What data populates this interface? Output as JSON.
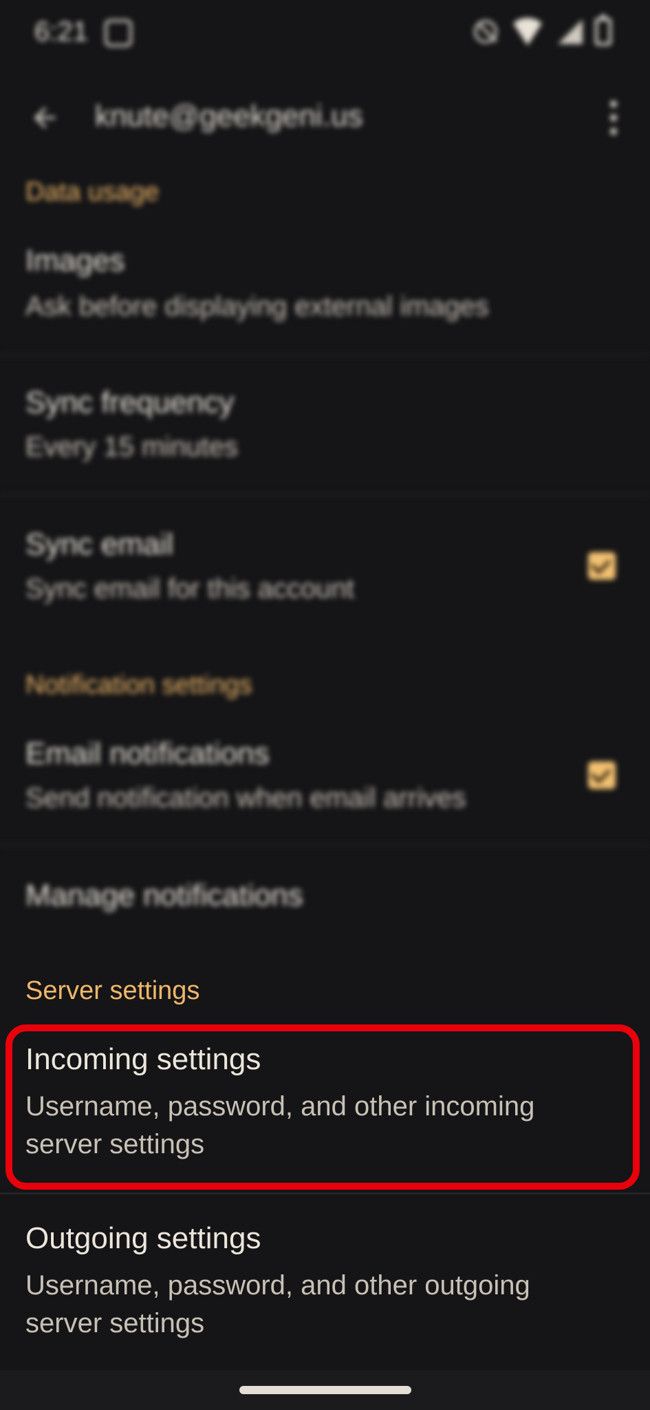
{
  "status_bar": {
    "time": "6:21",
    "icons": [
      "notification-icon",
      "mute-icon",
      "wifi-icon",
      "signal-icon",
      "battery-icon"
    ]
  },
  "app_bar": {
    "back_icon": "back-arrow-icon",
    "title": "knute@geekgeni.us",
    "more_icon": "more-vert-icon"
  },
  "sections": {
    "data_usage": {
      "header": "Data usage"
    },
    "notification": {
      "header": "Notification settings"
    },
    "server": {
      "header": "Server settings"
    }
  },
  "items": {
    "images": {
      "title": "Images",
      "subtitle": "Ask before displaying external images"
    },
    "sync_frequency": {
      "title": "Sync frequency",
      "subtitle": "Every 15 minutes"
    },
    "sync_email": {
      "title": "Sync email",
      "subtitle": "Sync email for this account",
      "checked": true
    },
    "email_notifications": {
      "title": "Email notifications",
      "subtitle": "Send notification when email arrives",
      "checked": true
    },
    "manage_notifications": {
      "title": "Manage notifications"
    },
    "incoming_settings": {
      "title": "Incoming settings",
      "subtitle_line1": "Username, password, and other incoming",
      "subtitle_line2": "server settings"
    },
    "outgoing_settings": {
      "title": "Outgoing settings",
      "subtitle_line1": "Username, password, and other outgoing",
      "subtitle_line2": "server settings"
    }
  },
  "colors": {
    "background": "#151517",
    "accent": "#f0b86a",
    "highlight": "#e8000b"
  }
}
